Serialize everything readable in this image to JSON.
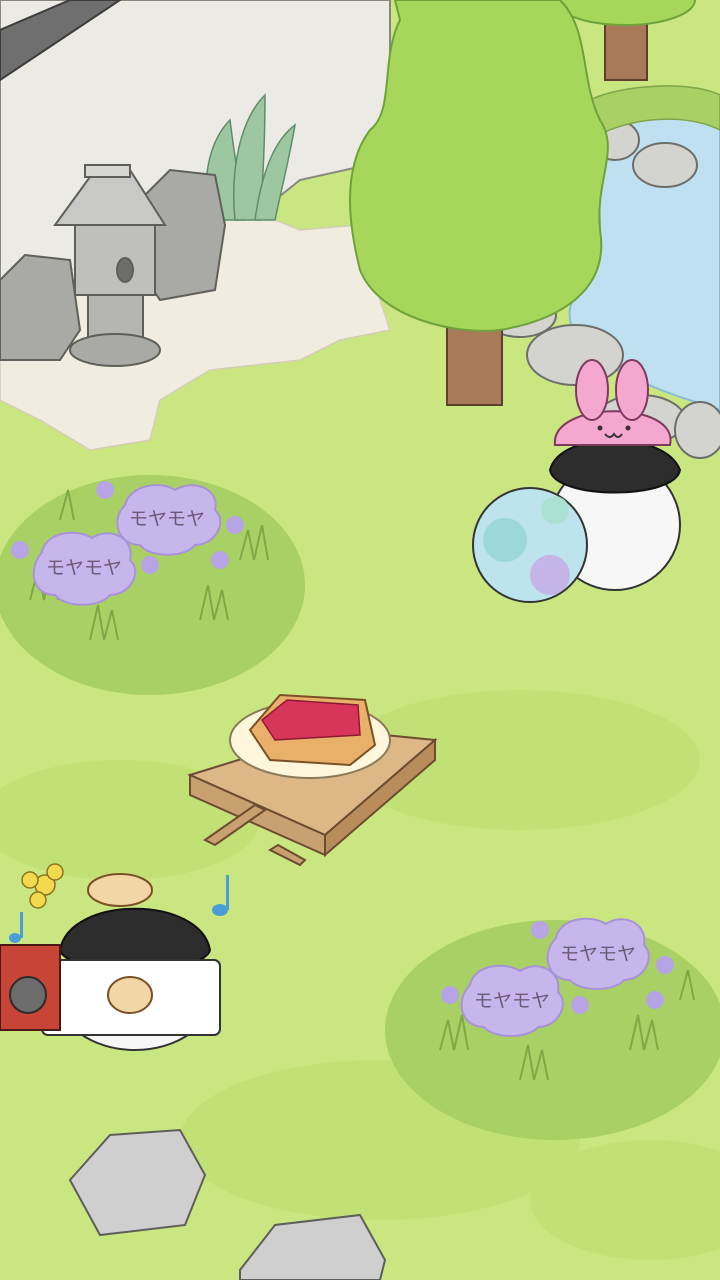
{
  "scene": {
    "name": "penguin-garden",
    "colors": {
      "grass": "#c9e680",
      "grass_dark": "#a9d064",
      "sand": "#f1ece0",
      "wall": "#eceae4",
      "pond": "#bfe0f0",
      "rock": "#cfcfcf",
      "leaf": "#a6d65a",
      "bark": "#a97a58",
      "cloud": "#c7b6ec",
      "jam": "#d8355a",
      "toast": "#e9b06a",
      "table": "#ddb886",
      "bunny_hat": "#f5a8cf",
      "ball": "#bde4ec",
      "music_note": "#4a9ed8"
    }
  },
  "clouds": [
    {
      "id": "cloud-1",
      "label": "モヤモヤ"
    },
    {
      "id": "cloud-2",
      "label": "モヤモヤ"
    },
    {
      "id": "cloud-3",
      "label": "モヤモヤ"
    },
    {
      "id": "cloud-4",
      "label": "モヤモヤ"
    }
  ],
  "characters": [
    {
      "id": "penguin-bunny-hat",
      "accessory": "bunny-hat",
      "holding": "beach-ball"
    },
    {
      "id": "penguin-toast-sign",
      "accessory": "bread-on-head",
      "holding": "toast-sign"
    }
  ],
  "items": [
    {
      "id": "jam-toast",
      "on": "picnic-table"
    },
    {
      "id": "radio"
    },
    {
      "id": "stone-lantern"
    }
  ]
}
